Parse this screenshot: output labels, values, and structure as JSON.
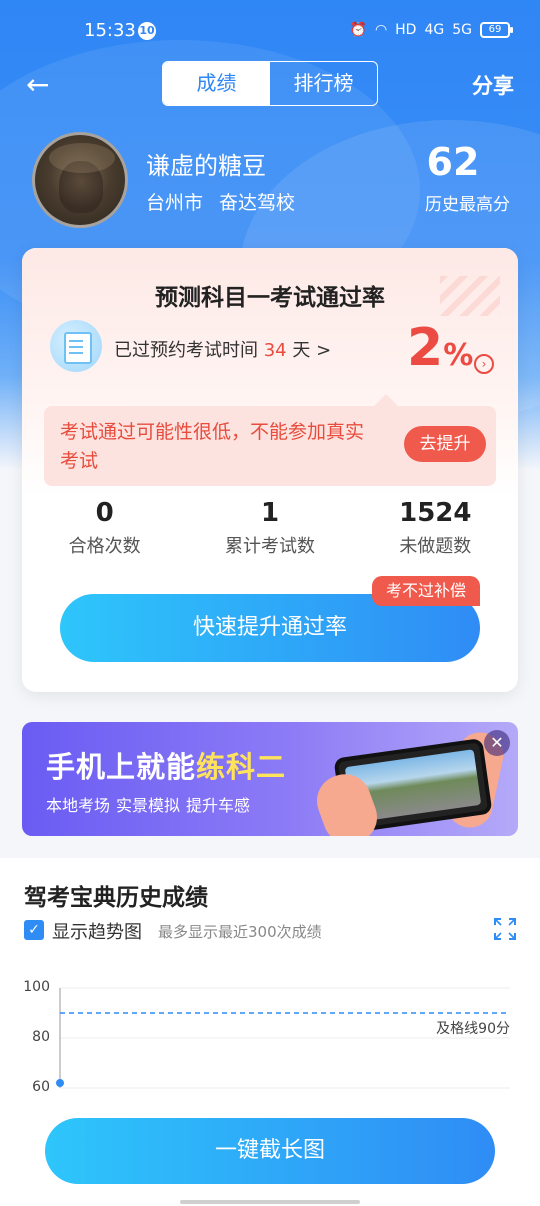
{
  "status_bar": {
    "time": "15:33",
    "notification_count": "10",
    "network_4g": "4G",
    "network_5g": "5G",
    "hd": "HD",
    "battery": "69"
  },
  "nav": {
    "tabs": [
      {
        "label": "成绩",
        "active": true
      },
      {
        "label": "排行榜",
        "active": false
      }
    ],
    "share_label": "分享",
    "back_icon": "arrow-left-icon"
  },
  "profile": {
    "name": "谦虚的糖豆",
    "city": "台州市",
    "school": "奋达驾校",
    "best_score": "62",
    "best_score_label": "历史最高分"
  },
  "prediction_card": {
    "title": "预测科目一考试通过率",
    "exam_time_prefix": "已过预约考试时间",
    "days": "34",
    "days_suffix": "天 >",
    "pass_rate_value": "2",
    "pass_rate_unit": "%",
    "warning_text": "考试通过可能性很低，不能参加真实考试",
    "improve_button": "去提升",
    "stats": [
      {
        "value": "0",
        "label": "合格次数"
      },
      {
        "value": "1",
        "label": "累计考试数"
      },
      {
        "value": "1524",
        "label": "未做题数"
      }
    ],
    "compensation_tag": "考不过补偿",
    "boost_button": "快速提升通过率"
  },
  "banner": {
    "title_main": "手机上就能",
    "title_highlight": "练科二",
    "subtitle": [
      "本地考场",
      "实景模拟",
      "提升车感"
    ]
  },
  "history": {
    "title": "驾考宝典历史成绩",
    "show_trend_label": "显示趋势图",
    "show_trend_checked": true,
    "hint": "最多显示最近300次成绩",
    "y_ticks": [
      "100",
      "80",
      "60"
    ],
    "pass_line_label": "及格线90分",
    "long_image_button": "一键截长图"
  },
  "chart_data": {
    "type": "line",
    "y": [
      62
    ],
    "ylim": [
      60,
      100
    ],
    "yticks": [
      100,
      80,
      60
    ],
    "reference_line": {
      "value": 90,
      "label": "及格线90分"
    }
  },
  "colors": {
    "primary_blue": "#2f8cf5",
    "accent_red": "#ec4b44",
    "banner_purple": "#6a5cf3",
    "highlight_yellow": "#ffe35a"
  }
}
